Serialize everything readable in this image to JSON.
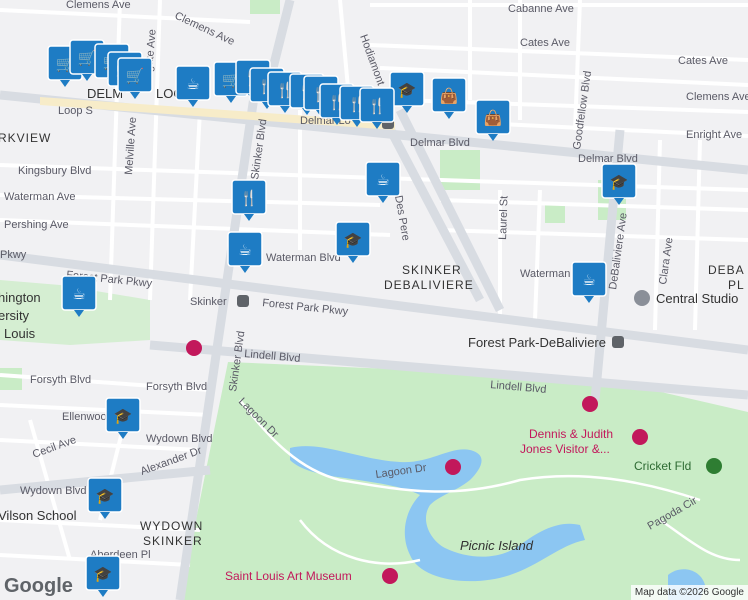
{
  "colors": {
    "park": "#c9ecc6",
    "water": "#8cc6f2",
    "road": "#ffffff",
    "major_road": "#d8dce2",
    "marker": "#1e7cc4",
    "loop_highlight": "#f7ecc9"
  },
  "areas": {
    "parkview": "RKVIEW",
    "skinker_debaliviere_1": "SKINKER",
    "skinker_debaliviere_2": "DEBALIVIERE",
    "wydown_skinker_1": "WYDOWN",
    "wydown_skinker_2": "SKINKER",
    "debal_1": "DEBA",
    "debal_2": "PL",
    "wash_u_1": "hington",
    "wash_u_2": "ersity",
    "wash_u_3": "Louis"
  },
  "streets": {
    "clemens_ave_1": "Clemens Ave",
    "clemens_ave_2": "Clemens Ave",
    "clemens_ave_3": "Clemens Ave",
    "cabanne": "Cabanne Ave",
    "cates_1": "Cates Ave",
    "cates_2": "Cates Ave",
    "enright": "Enright Ave",
    "delmar_1": "Delmar Blvd",
    "delmar_2": "Delmar Blvd",
    "delmar_loop_1": "DELM",
    "delmar_loop_2": "LOO",
    "loop_s": "Loop S",
    "kingsbury": "Kingsbury Blvd",
    "waterman_1": "Waterman Ave",
    "waterman_2": "Waterman Blvd",
    "waterman_3": "Waterman",
    "pershing": "Pershing Ave",
    "forest_park_pkwy_1": "Forest Park Pkwy",
    "forest_park_pkwy_2": "Forest Park Pkwy",
    "pkwy": "Pkwy",
    "skinker_blvd_1": "Skinker Blvd",
    "skinker_blvd_2": "Skinker Blvd",
    "skinker_station": "Skinker",
    "lindell_1": "Lindell Blvd",
    "lindell_2": "Lindell Blvd",
    "forsyth_1": "Forsyth Blvd",
    "forsyth_2": "Forsyth Blvd",
    "wydown_1": "Wydown Blvd",
    "wydown_2": "Wydown Blvd",
    "ellenwood": "Ellenwood",
    "cecil": "Cecil Ave",
    "alexander": "Alexander Dr",
    "aberdeen": "Aberdeen Pl",
    "lagoon_dr_1": "Lagoon Dr",
    "lagoon_dr_2": "Lagoon Dr",
    "pagoda": "Pagoda Cir",
    "melville": "Melville Ave",
    "hodiamont": "Hodiamont",
    "des_peres": "Des Pere",
    "laurel": "Laurel St",
    "goodfellow": "Goodfellow Blvd",
    "debaliviere_ave": "DeBaliviere Ave",
    "clara": "Clara Ave",
    "gate": "gate Ave"
  },
  "pois": {
    "central_studio": "Central Studio",
    "forest_park_debaliviere": "Forest Park-DeBaliviere",
    "visitor_1": "Dennis & Judith",
    "visitor_2": "Jones Visitor &...",
    "cricket": "Cricket Fld",
    "picnic_island": "Picnic Island",
    "art_museum": "Saint Louis Art Museum",
    "wilson_school": "Vilson School",
    "delmar_loop_station": "Delmar Lo"
  },
  "footer": {
    "google": "Google",
    "attribution": "Map data ©2026 Google"
  },
  "marker_icons": {
    "cart": "🛒",
    "cup": "☕",
    "food": "🍴",
    "school": "🎓",
    "bag": "👜"
  },
  "markers": [
    {
      "icon": "cart"
    },
    {
      "icon": "cart"
    },
    {
      "icon": "cart"
    },
    {
      "icon": "cart"
    },
    {
      "icon": "cup"
    },
    {
      "icon": "cart"
    },
    {
      "icon": "cart"
    },
    {
      "icon": "food"
    },
    {
      "icon": "food"
    },
    {
      "icon": "food"
    },
    {
      "icon": "food"
    },
    {
      "icon": "food"
    },
    {
      "icon": "school"
    },
    {
      "icon": "bag"
    },
    {
      "icon": "food"
    },
    {
      "icon": "food"
    },
    {
      "icon": "food"
    },
    {
      "icon": "bag"
    },
    {
      "icon": "cup"
    },
    {
      "icon": "food"
    },
    {
      "icon": "school"
    },
    {
      "icon": "cup"
    },
    {
      "icon": "cup"
    },
    {
      "icon": "cup"
    },
    {
      "icon": "school"
    },
    {
      "icon": "school"
    },
    {
      "icon": "school"
    },
    {
      "icon": "school"
    }
  ]
}
